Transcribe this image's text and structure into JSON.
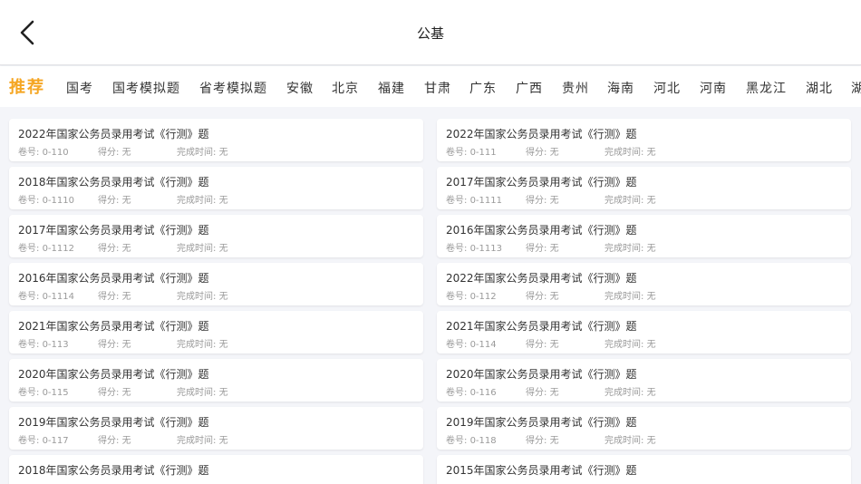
{
  "header": {
    "title": "公基",
    "back_icon": "chevron-left-icon"
  },
  "tabs": [
    {
      "label": "推荐",
      "active": true
    },
    {
      "label": "国考",
      "active": false
    },
    {
      "label": "国考模拟题",
      "active": false
    },
    {
      "label": "省考模拟题",
      "active": false
    },
    {
      "label": "安徽",
      "active": false
    },
    {
      "label": "北京",
      "active": false
    },
    {
      "label": "福建",
      "active": false
    },
    {
      "label": "甘肃",
      "active": false
    },
    {
      "label": "广东",
      "active": false
    },
    {
      "label": "广西",
      "active": false
    },
    {
      "label": "贵州",
      "active": false
    },
    {
      "label": "海南",
      "active": false
    },
    {
      "label": "河北",
      "active": false
    },
    {
      "label": "河南",
      "active": false
    },
    {
      "label": "黑龙江",
      "active": false
    },
    {
      "label": "湖北",
      "active": false
    },
    {
      "label": "湖",
      "active": false
    }
  ],
  "colors": {
    "accent": "#f5a623",
    "background": "#f4f5f9",
    "card": "#ffffff"
  },
  "labels": {
    "paper_no": "卷号: ",
    "score": "得分: ",
    "finish_time": "完成时间: "
  },
  "papers": [
    {
      "title": "2022年国家公务员录用考试《行测》题",
      "paper_no": "0-110",
      "score": "无",
      "finish_time": "无"
    },
    {
      "title": "2022年国家公务员录用考试《行测》题",
      "paper_no": "0-111",
      "score": "无",
      "finish_time": "无"
    },
    {
      "title": "2018年国家公务员录用考试《行测》题",
      "paper_no": "0-1110",
      "score": "无",
      "finish_time": "无"
    },
    {
      "title": "2017年国家公务员录用考试《行测》题",
      "paper_no": "0-1111",
      "score": "无",
      "finish_time": "无"
    },
    {
      "title": "2017年国家公务员录用考试《行测》题",
      "paper_no": "0-1112",
      "score": "无",
      "finish_time": "无"
    },
    {
      "title": "2016年国家公务员录用考试《行测》题",
      "paper_no": "0-1113",
      "score": "无",
      "finish_time": "无"
    },
    {
      "title": "2016年国家公务员录用考试《行测》题",
      "paper_no": "0-1114",
      "score": "无",
      "finish_time": "无"
    },
    {
      "title": "2022年国家公务员录用考试《行测》题",
      "paper_no": "0-112",
      "score": "无",
      "finish_time": "无"
    },
    {
      "title": "2021年国家公务员录用考试《行测》题",
      "paper_no": "0-113",
      "score": "无",
      "finish_time": "无"
    },
    {
      "title": "2021年国家公务员录用考试《行测》题",
      "paper_no": "0-114",
      "score": "无",
      "finish_time": "无"
    },
    {
      "title": "2020年国家公务员录用考试《行测》题",
      "paper_no": "0-115",
      "score": "无",
      "finish_time": "无"
    },
    {
      "title": "2020年国家公务员录用考试《行测》题",
      "paper_no": "0-116",
      "score": "无",
      "finish_time": "无"
    },
    {
      "title": "2019年国家公务员录用考试《行测》题",
      "paper_no": "0-117",
      "score": "无",
      "finish_time": "无"
    },
    {
      "title": "2019年国家公务员录用考试《行测》题",
      "paper_no": "0-118",
      "score": "无",
      "finish_time": "无"
    },
    {
      "title": "2018年国家公务员录用考试《行测》题",
      "paper_no": "",
      "score": "",
      "finish_time": ""
    },
    {
      "title": "2015年国家公务员录用考试《行测》题",
      "paper_no": "",
      "score": "",
      "finish_time": ""
    }
  ]
}
